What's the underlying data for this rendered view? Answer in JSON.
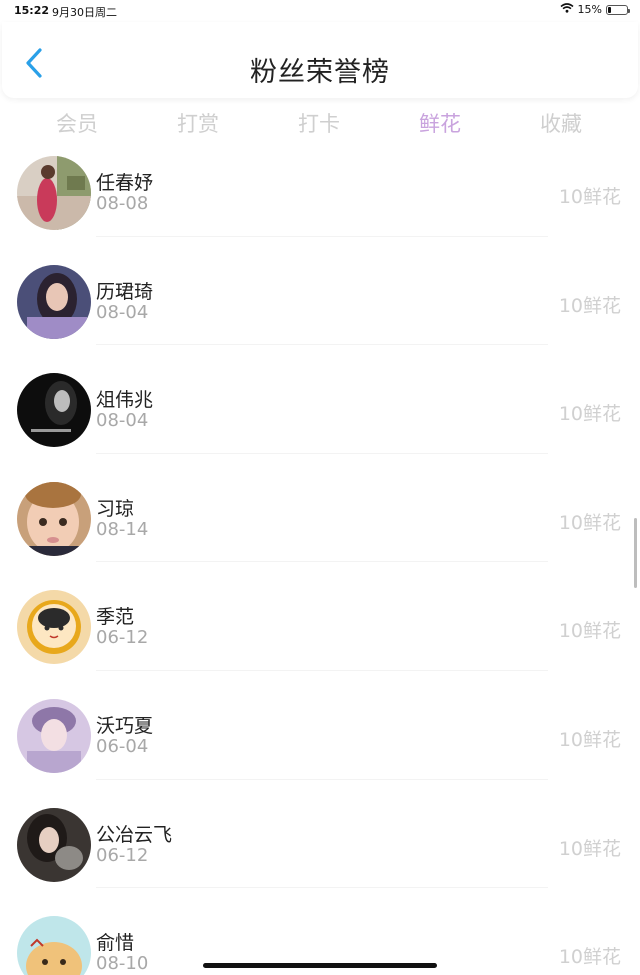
{
  "status_bar": {
    "time": "15:22",
    "date": "9月30日周二",
    "battery_text": "15%",
    "battery_level": 0.15
  },
  "nav": {
    "title": "粉丝荣誉榜"
  },
  "tabs": [
    {
      "label": "会员",
      "active": false
    },
    {
      "label": "打赏",
      "active": false
    },
    {
      "label": "打卡",
      "active": false
    },
    {
      "label": "鲜花",
      "active": true
    },
    {
      "label": "收藏",
      "active": false
    }
  ],
  "colors": {
    "active_tab": "#c9a3de",
    "inactive_tab": "#cfcfcf",
    "back_icon": "#2aa0e8"
  },
  "fans": [
    {
      "name": "任春妤",
      "date": "08-08",
      "amount": "10鲜花"
    },
    {
      "name": "历珺琦",
      "date": "08-04",
      "amount": "10鲜花"
    },
    {
      "name": "俎伟兆",
      "date": "08-04",
      "amount": "10鲜花"
    },
    {
      "name": "习琼",
      "date": "08-14",
      "amount": "10鲜花"
    },
    {
      "name": "季范",
      "date": "06-12",
      "amount": "10鲜花"
    },
    {
      "name": "沃巧夏",
      "date": "06-04",
      "amount": "10鲜花"
    },
    {
      "name": "公冶云飞",
      "date": "06-12",
      "amount": "10鲜花"
    },
    {
      "name": "俞惜",
      "date": "08-10",
      "amount": "10鲜花"
    }
  ]
}
